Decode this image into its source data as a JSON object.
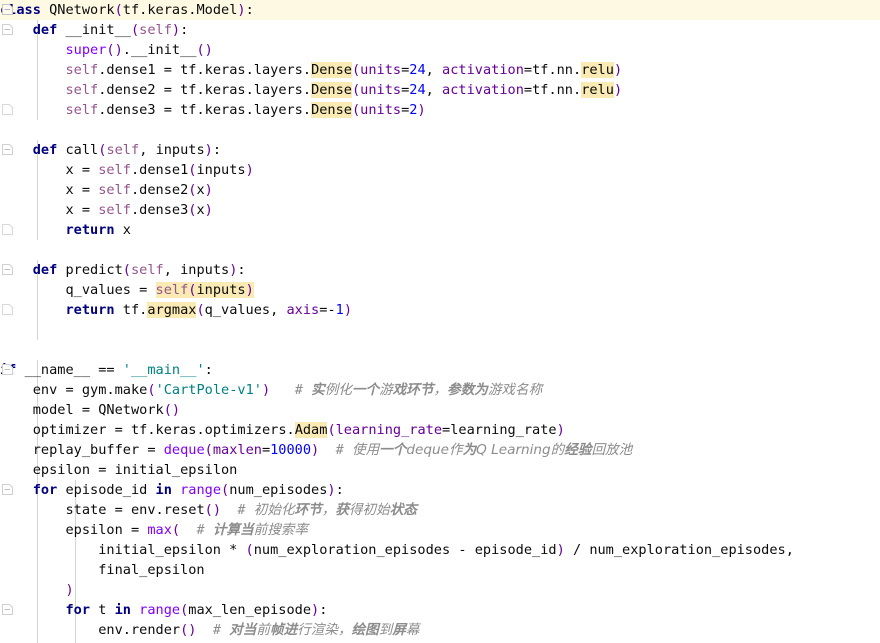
{
  "editor": {
    "name": "python-code-editor",
    "language": "python",
    "current_line_index": 0,
    "colors": {
      "background": "#ffffff",
      "current_line": "#fdf9e3",
      "highlight": "#faeab4",
      "keyword": "#000080",
      "string": "#008080",
      "number": "#0000ff",
      "comment": "#8c8c8c",
      "self": "#94558d",
      "builtin": "#8000ff",
      "param": "#660099",
      "indent_guide": "#d4d4d4",
      "fold_marker": "#c8c8c8"
    },
    "gutter": {
      "fold_markers": [
        {
          "type": "fold-open-icon",
          "line": 0
        },
        {
          "type": "fold-open-icon",
          "line": 1
        },
        {
          "type": "fold-close-icon",
          "line": 5
        },
        {
          "type": "fold-open-icon",
          "line": 7
        },
        {
          "type": "fold-close-icon",
          "line": 11
        },
        {
          "type": "fold-open-icon",
          "line": 13
        },
        {
          "type": "fold-close-icon",
          "line": 15
        },
        {
          "type": "fold-open-icon",
          "line": 18
        },
        {
          "type": "fold-open-icon",
          "line": 24
        },
        {
          "type": "fold-open-icon",
          "line": 30
        }
      ]
    },
    "highlighted_tokens": [
      "Dense",
      "relu",
      "self(inputs)",
      "argmax",
      "Adam"
    ],
    "code_lines": [
      "class QNetwork(tf.keras.Model):",
      "    def __init__(self):",
      "        super().__init__()",
      "        self.dense1 = tf.keras.layers.Dense(units=24, activation=tf.nn.relu)",
      "        self.dense2 = tf.keras.layers.Dense(units=24, activation=tf.nn.relu)",
      "        self.dense3 = tf.keras.layers.Dense(units=2)",
      "",
      "    def call(self, inputs):",
      "        x = self.dense1(inputs)",
      "        x = self.dense2(x)",
      "        x = self.dense3(x)",
      "        return x",
      "",
      "    def predict(self, inputs):",
      "        q_values = self(inputs)",
      "        return tf.argmax(q_values, axis=-1)",
      "",
      "",
      "if __name__ == '__main__':",
      "    env = gym.make('CartPole-v1')   # 实例化一个游戏环节，参数为游戏名称",
      "    model = QNetwork()",
      "    optimizer = tf.keras.optimizers.Adam(learning_rate=learning_rate)",
      "    replay_buffer = deque(maxlen=10000)   # 使用一个deque作为Q Learning的经验回放池",
      "    epsilon = initial_epsilon",
      "    for episode_id in range(num_episodes):",
      "        state = env.reset()   # 初始化环节，获得初始状态",
      "        epsilon = max(   # 计算当前搜索率",
      "            initial_epsilon * (num_exploration_episodes - episode_id) / num_exploration_episodes,",
      "            final_epsilon",
      "        )",
      "        for t in range(max_len_episode):",
      "            env.render()   # 对当前帧进行渲染，绘图到屏幕"
    ],
    "comments": [
      {
        "line": 18,
        "text": "# 实例化一个游戏环节，参数为游戏名称"
      },
      {
        "line": 21,
        "text": "# 使用一个deque作为Q Learning的经验回放池"
      },
      {
        "line": 24,
        "text": "# 初始化环节，获得初始状态"
      },
      {
        "line": 25,
        "text": "# 计算当前搜索率"
      },
      {
        "line": 30,
        "text": "# 对当前帧进行渲染，绘图到屏幕"
      }
    ],
    "identifiers": {
      "class_name": "QNetwork",
      "base_class": "tf.keras.Model",
      "methods": [
        "__init__",
        "call",
        "predict"
      ],
      "layers": [
        "self.dense1",
        "self.dense2",
        "self.dense3"
      ],
      "units_1": "24",
      "units_2": "24",
      "units_3": "2",
      "activation": "tf.nn.relu",
      "env_name": "CartPole-v1",
      "optimizer": "Adam",
      "learning_rate_kwarg": "learning_rate",
      "maxlen": "10000",
      "axis": "-1"
    }
  }
}
